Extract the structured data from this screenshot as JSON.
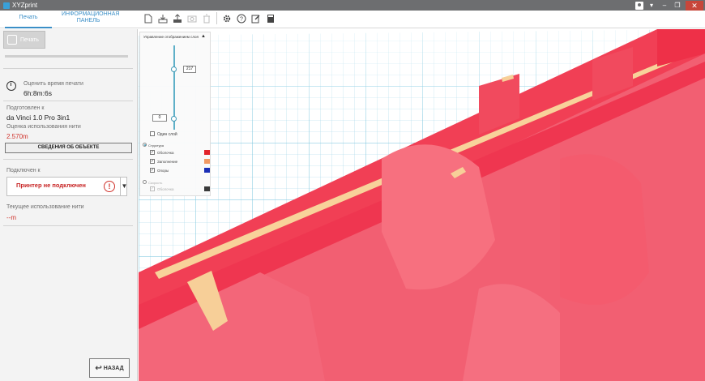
{
  "window": {
    "title": "XYZprint"
  },
  "tabs": {
    "print": "Печать",
    "info": "ИНФОРМАЦИОННАЯ ПАНЕЛЬ"
  },
  "toolbar_icons": [
    "new-file-icon",
    "import-icon",
    "export-icon",
    "camera-icon",
    "delete-icon",
    "settings-icon",
    "help-icon",
    "edit-icon",
    "calculator-icon"
  ],
  "left": {
    "print_button": "Печать",
    "print_progress": 0,
    "estimate_label": "Оценить время печати",
    "estimate_value": "6h:8m:6s",
    "prepared_label": "Подготовлен к",
    "prepared_value": "da Vinci 1.0 Pro 3in1",
    "filament_label": "Оценка использования нити",
    "filament_value": "2.570m",
    "details_button": "СВЕДЕНИЯ ОБ ОБЪЕКТЕ",
    "connected_label": "Подключен к",
    "printer_status": "Принтер не подключен",
    "current_label": "Текущее использование нити",
    "current_value": "--m",
    "back_button": "НАЗАД"
  },
  "layer_panel": {
    "title": "Управление отображением слоя",
    "top_value": "217",
    "bottom_value": "0",
    "single_layer": "Один слой",
    "structure": "Структура",
    "items": [
      {
        "label": "Оболочка",
        "checked": true,
        "color": "#e2232a"
      },
      {
        "label": "Заполнение",
        "checked": true,
        "color": "#f29a64"
      },
      {
        "label": "Опоры",
        "checked": true,
        "color": "#1b2fb6"
      }
    ],
    "speed": "Скорость",
    "speed_item": "Оболочка",
    "speed_color": "#3a3a3a"
  },
  "colors": {
    "accent": "#3b8fc7",
    "model": "#f15062",
    "infill": "#f6cf96",
    "grid": "#8fd0e4"
  }
}
